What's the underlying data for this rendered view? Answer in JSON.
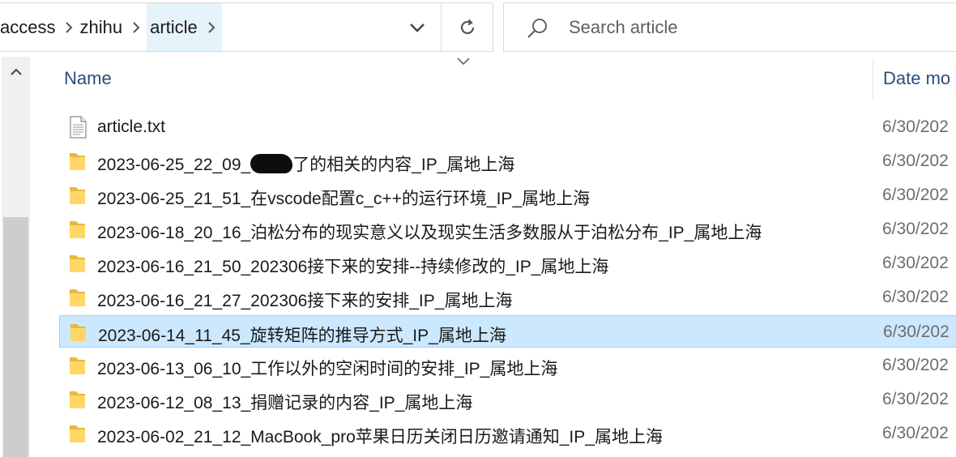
{
  "breadcrumb": {
    "items": [
      "access",
      "zhihu",
      "article"
    ]
  },
  "search": {
    "placeholder": "Search article"
  },
  "columns": {
    "name": "Name",
    "date": "Date mo"
  },
  "files": [
    {
      "type": "text",
      "name": "article.txt",
      "date": "6/30/202",
      "selected": false
    },
    {
      "type": "folder",
      "name_prefix": "2023-06-25_22_09_",
      "name": "了的相关的内容_IP_属地上海",
      "redacted": true,
      "date": "6/30/202",
      "selected": false
    },
    {
      "type": "folder",
      "name": "2023-06-25_21_51_在vscode配置c_c++的运行环境_IP_属地上海",
      "date": "6/30/202",
      "selected": false
    },
    {
      "type": "folder",
      "name": "2023-06-18_20_16_泊松分布的现实意义以及现实生活多数服从于泊松分布_IP_属地上海",
      "date": "6/30/202",
      "selected": false
    },
    {
      "type": "folder",
      "name": "2023-06-16_21_50_202306接下来的安排--持续修改的_IP_属地上海",
      "date": "6/30/202",
      "selected": false
    },
    {
      "type": "folder",
      "name": "2023-06-16_21_27_202306接下来的安排_IP_属地上海",
      "date": "6/30/202",
      "selected": false
    },
    {
      "type": "folder",
      "name": "2023-06-14_11_45_旋转矩阵的推导方式_IP_属地上海",
      "date": "6/30/202",
      "selected": true
    },
    {
      "type": "folder",
      "name": "2023-06-13_06_10_工作以外的空闲时间的安排_IP_属地上海",
      "date": "6/30/202",
      "selected": false
    },
    {
      "type": "folder",
      "name": "2023-06-12_08_13_捐赠记录的内容_IP_属地上海",
      "date": "6/30/202",
      "selected": false
    },
    {
      "type": "folder",
      "name": "2023-06-02_21_12_MacBook_pro苹果日历关闭日历邀请通知_IP_属地上海",
      "date": "6/30/202",
      "selected": false
    }
  ],
  "colors": {
    "selected_bg": "#cce8ff",
    "selected_border": "#99d1ff",
    "folder": "#ffd766",
    "breadcrumb_current_bg": "#e5f3fb",
    "header_text": "#2b4d7a"
  },
  "icons": {
    "sep": "chevron-right-icon",
    "dropdown": "chevron-down-icon",
    "refresh": "refresh-icon",
    "search": "search-icon",
    "folder": "folder-icon",
    "text_file": "text-file-icon",
    "scroll_up": "scroll-up-arrow-icon"
  }
}
